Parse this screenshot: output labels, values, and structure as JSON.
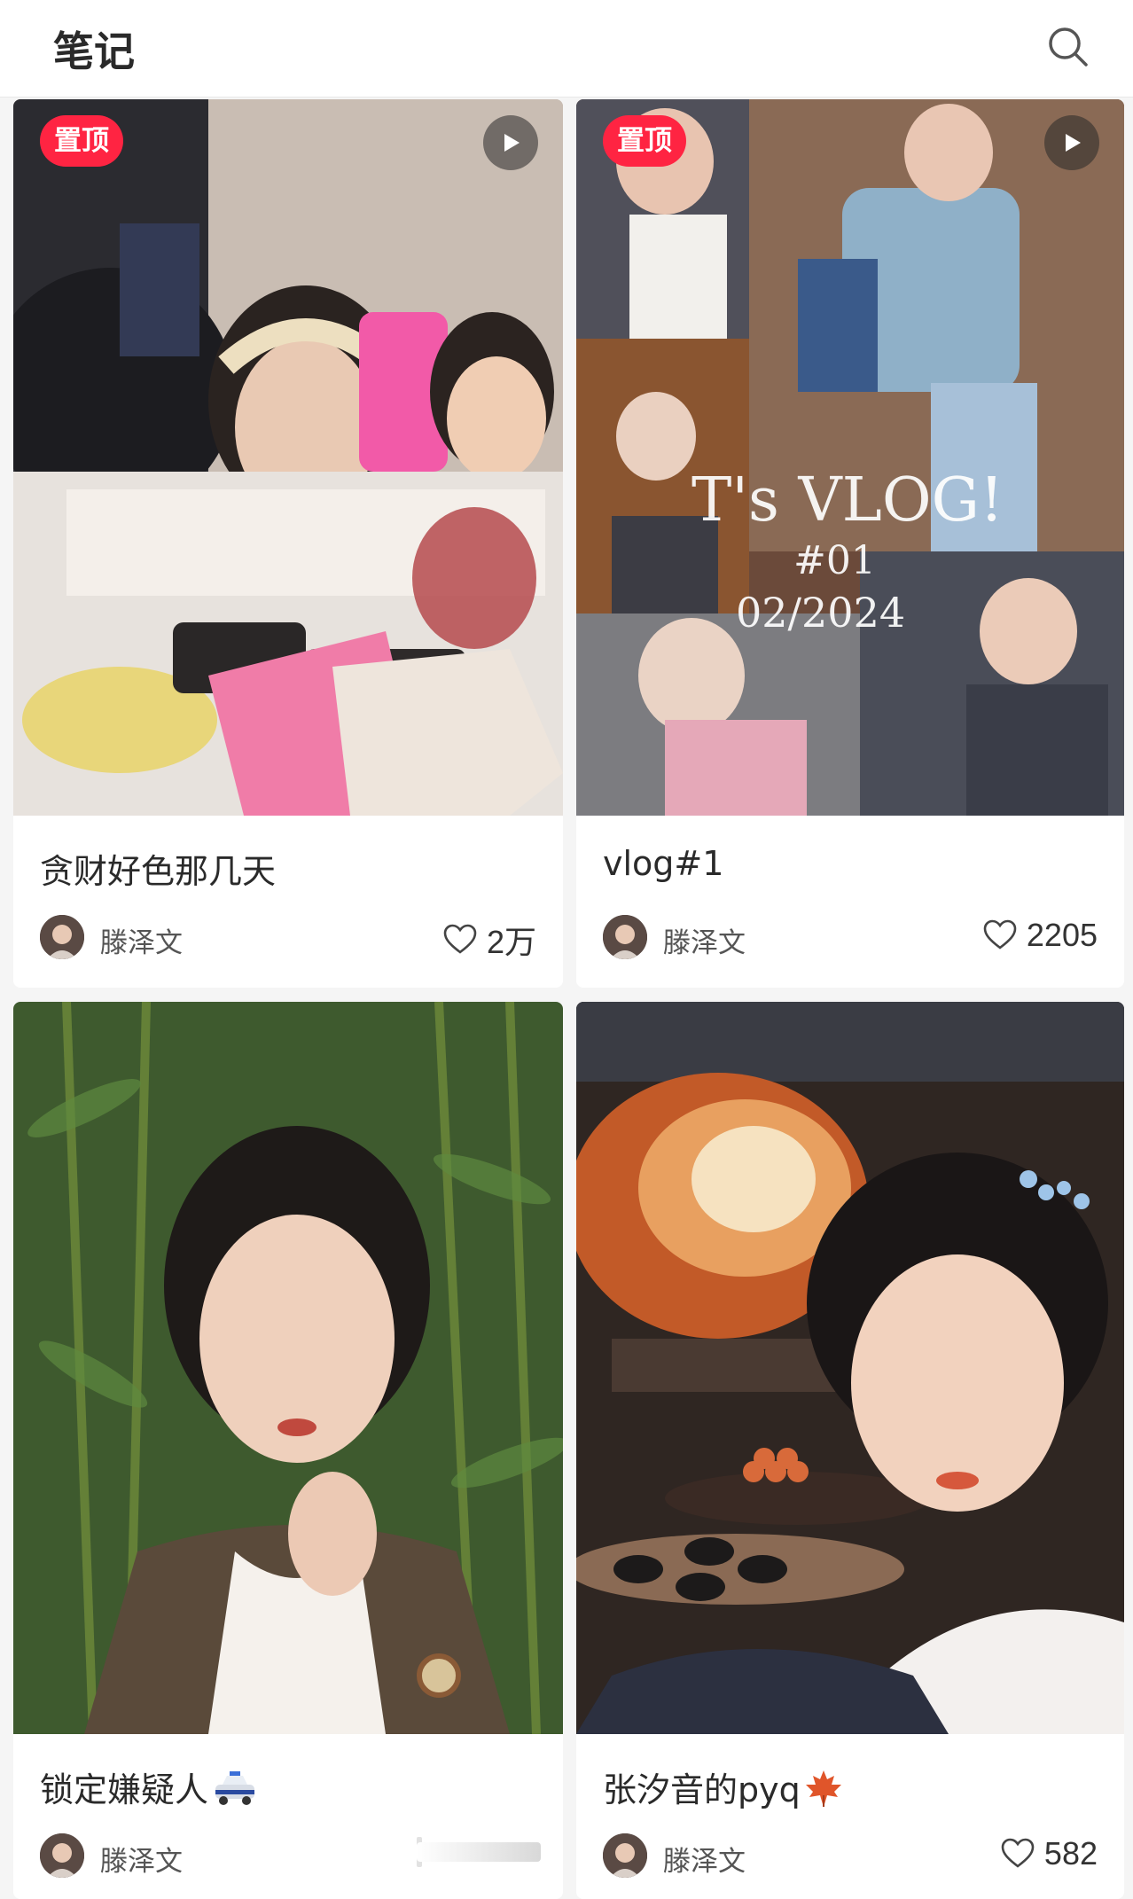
{
  "header": {
    "title": "笔记",
    "search_icon": "search-icon"
  },
  "notes": [
    {
      "title": "贪财好色那几天",
      "badge": "置顶",
      "is_video": true,
      "author": "滕泽文",
      "likes": "2万"
    },
    {
      "title": "vlog#1",
      "badge": "置顶",
      "is_video": true,
      "author": "滕泽文",
      "likes": "2205",
      "cover_text": {
        "line1": "T's VLOG!",
        "line2": "#01",
        "line3": "02/2024"
      }
    },
    {
      "title": "锁定嫌疑人",
      "title_emoji": "police-car-icon",
      "author": "滕泽文",
      "likes": ""
    },
    {
      "title": "张汐音的pyq",
      "title_emoji": "maple-leaf-icon",
      "author": "滕泽文",
      "likes": "582"
    }
  ],
  "colors": {
    "badge": "#ff2442",
    "background": "#f5f5f5",
    "card": "#ffffff"
  }
}
